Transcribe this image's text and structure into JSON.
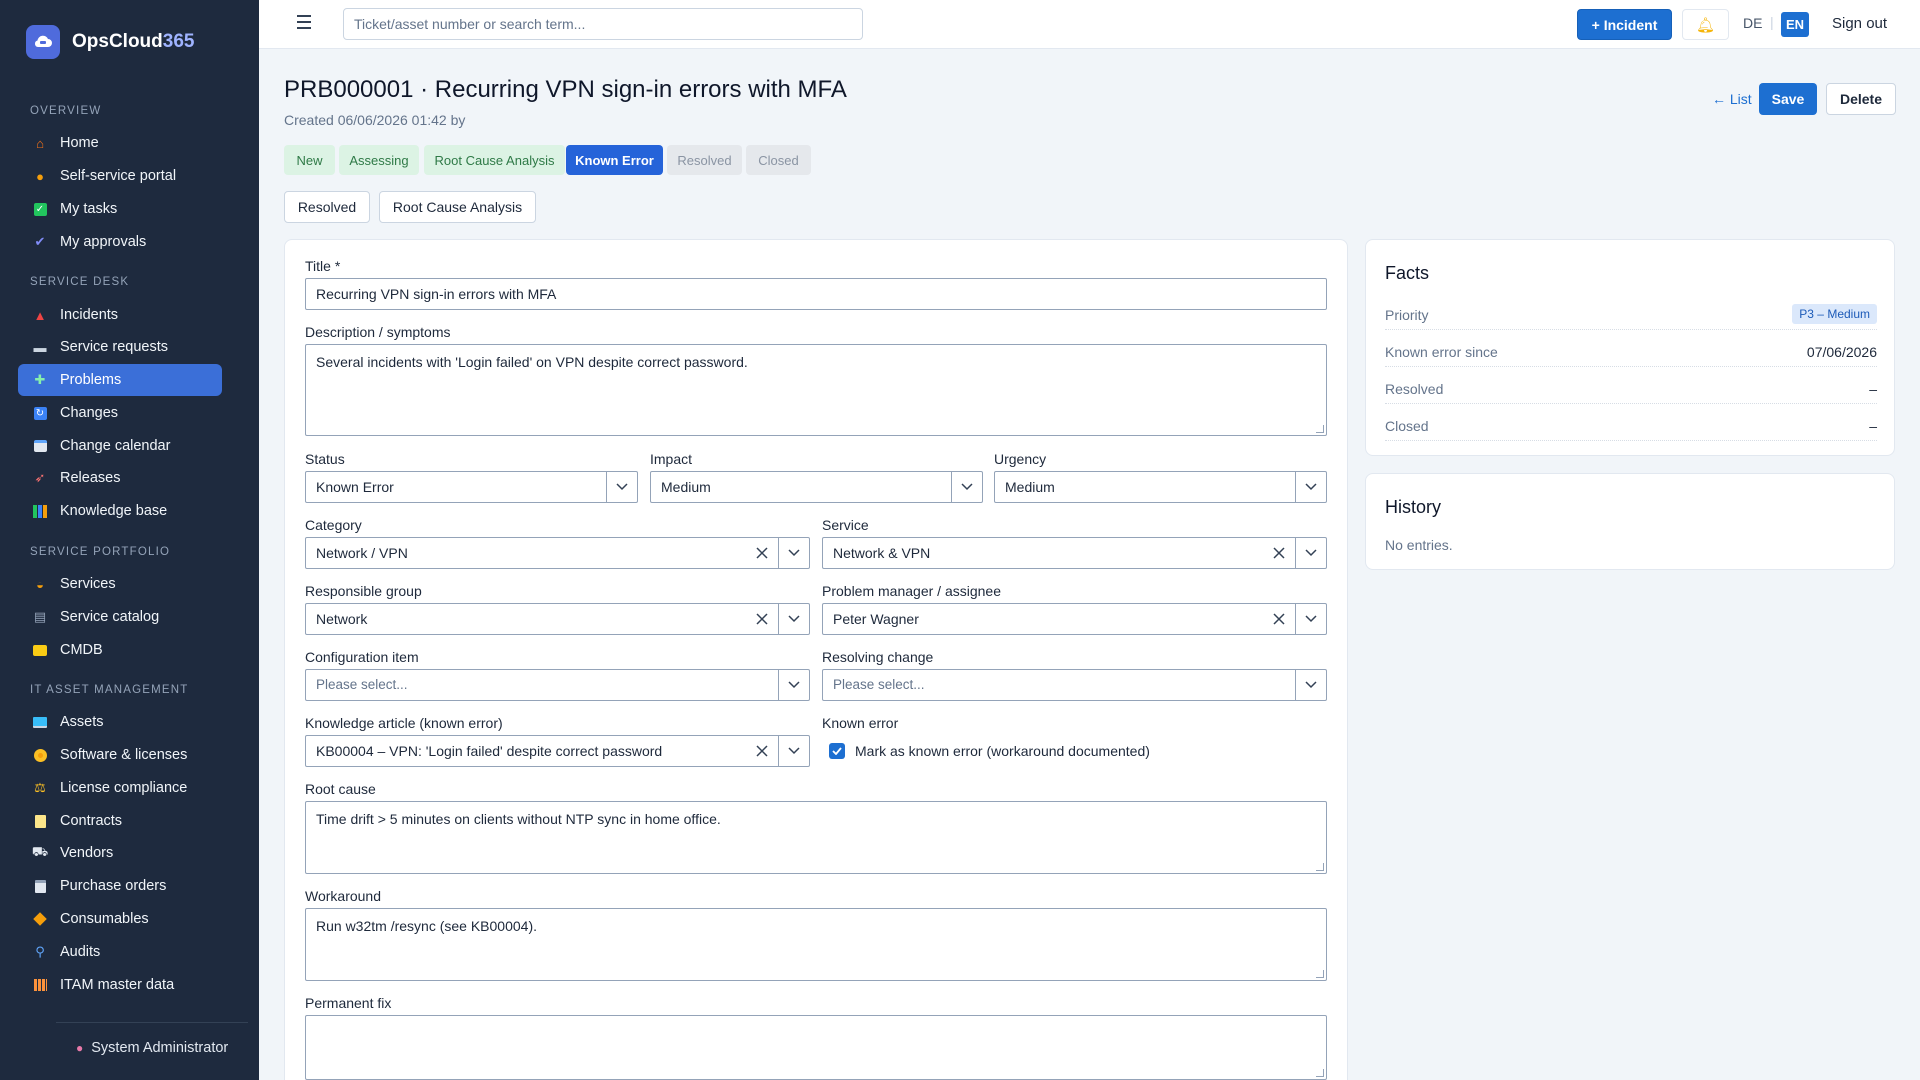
{
  "app": {
    "name_main": "OpsCloud",
    "name_accent": "365"
  },
  "sidebar": {
    "sections": [
      {
        "label": "OVERVIEW"
      },
      {
        "label": "SERVICE DESK"
      },
      {
        "label": "SERVICE PORTFOLIO"
      },
      {
        "label": "IT ASSET MANAGEMENT"
      }
    ],
    "items": [
      {
        "label": "Home",
        "icon": "home-icon"
      },
      {
        "label": "Self-service portal",
        "icon": "person-icon"
      },
      {
        "label": "My tasks",
        "icon": "checkbox-icon"
      },
      {
        "label": "My approvals",
        "icon": "checkmark-icon"
      },
      {
        "label": "Incidents",
        "icon": "siren-icon"
      },
      {
        "label": "Service requests",
        "icon": "inbox-icon"
      },
      {
        "label": "Problems",
        "icon": "puzzle-icon"
      },
      {
        "label": "Changes",
        "icon": "cycle-icon"
      },
      {
        "label": "Change calendar",
        "icon": "calendar-icon"
      },
      {
        "label": "Releases",
        "icon": "rocket-icon"
      },
      {
        "label": "Knowledge base",
        "icon": "books-icon"
      },
      {
        "label": "Services",
        "icon": "bell-service-icon"
      },
      {
        "label": "Service catalog",
        "icon": "catalog-icon"
      },
      {
        "label": "CMDB",
        "icon": "folder-icon"
      },
      {
        "label": "Assets",
        "icon": "monitor-icon"
      },
      {
        "label": "Software & licenses",
        "icon": "disc-icon"
      },
      {
        "label": "License compliance",
        "icon": "scales-icon"
      },
      {
        "label": "Contracts",
        "icon": "document-icon"
      },
      {
        "label": "Vendors",
        "icon": "truck-icon"
      },
      {
        "label": "Purchase orders",
        "icon": "clipboard-icon"
      },
      {
        "label": "Consumables",
        "icon": "package-icon"
      },
      {
        "label": "Audits",
        "icon": "magnifier-icon"
      },
      {
        "label": "ITAM master data",
        "icon": "grid-icon"
      }
    ],
    "active": "Problems",
    "user": "System Administrator"
  },
  "topbar": {
    "search_placeholder": "Ticket/asset number or search term...",
    "incident_button": "+ Incident",
    "lang_de": "DE",
    "lang_sep": "|",
    "lang_en": "EN",
    "signout": "Sign out"
  },
  "page": {
    "title": "PRB000001 · Recurring VPN sign-in errors with MFA",
    "subtitle": "Created 06/06/2026 01:42 by",
    "list_link": "← List",
    "save": "Save",
    "delete": "Delete"
  },
  "workflow": {
    "steps": [
      {
        "label": "New",
        "state": "done"
      },
      {
        "label": "Assessing",
        "state": "done"
      },
      {
        "label": "Root Cause Analysis",
        "state": "done"
      },
      {
        "label": "Known Error",
        "state": "current"
      },
      {
        "label": "Resolved",
        "state": "todo"
      },
      {
        "label": "Closed",
        "state": "todo"
      }
    ],
    "transitions": [
      "Resolved",
      "Root Cause Analysis"
    ]
  },
  "form": {
    "title_label": "Title *",
    "title_value": "Recurring VPN sign-in errors with MFA",
    "description_label": "Description / symptoms",
    "description_value": "Several incidents with 'Login failed' on VPN despite correct password.",
    "status_label": "Status",
    "status_value": "Known Error",
    "impact_label": "Impact",
    "impact_value": "Medium",
    "urgency_label": "Urgency",
    "urgency_value": "Medium",
    "category_label": "Category",
    "category_value": "Network / VPN",
    "service_label": "Service",
    "service_value": "Network & VPN",
    "group_label": "Responsible group",
    "group_value": "Network",
    "manager_label": "Problem manager / assignee",
    "manager_value": "Peter Wagner",
    "ci_label": "Configuration item",
    "ci_placeholder": "Please select...",
    "change_label": "Resolving change",
    "change_placeholder": "Please select...",
    "kb_label": "Knowledge article (known error)",
    "kb_value": "KB00004 – VPN: 'Login failed' despite correct password",
    "known_error_label": "Known error",
    "known_error_checkbox": "Mark as known error (workaround documented)",
    "known_error_checked": true,
    "root_cause_label": "Root cause",
    "root_cause_value": "Time drift > 5 minutes on clients without NTP sync in home office.",
    "workaround_label": "Workaround",
    "workaround_value": "Run w32tm /resync (see KB00004).",
    "permanent_fix_label": "Permanent fix",
    "permanent_fix_value": ""
  },
  "facts": {
    "title": "Facts",
    "rows": [
      {
        "key": "Priority",
        "value": "P3 – Medium"
      },
      {
        "key": "Known error since",
        "value": "07/06/2026"
      },
      {
        "key": "Resolved",
        "value": "–"
      },
      {
        "key": "Closed",
        "value": "–"
      }
    ]
  },
  "history": {
    "title": "History",
    "empty": "No entries."
  },
  "colors": {
    "sidebar": "#1e2a3e",
    "primary": "#1d6fd1",
    "active_nav": "#3b6fd8",
    "step_done": "#dcf3e4",
    "step_current": "#2563d9"
  }
}
